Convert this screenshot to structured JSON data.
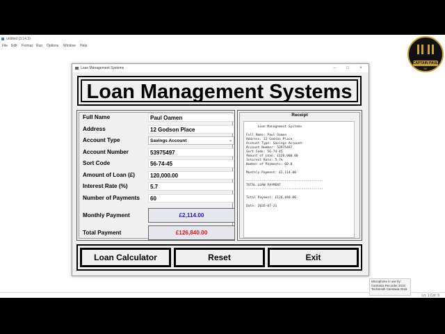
{
  "editor": {
    "title": "untitled (3.14.3)",
    "menu": [
      "File",
      "Edit",
      "Format",
      "Run",
      "Options",
      "Window",
      "Help"
    ],
    "status": "Ln: 1  Col: 0"
  },
  "logo": {
    "text": "CAPTAIN PAUL",
    "subtext": "BE"
  },
  "notice": {
    "lines": [
      "Microphone in use by:",
      "Camtasia Recorder 2018",
      "TechSmith Camtasia 2018"
    ]
  },
  "window": {
    "title": "Loan Management Systems",
    "controls": [
      "–",
      "□",
      "×"
    ]
  },
  "heading": "Loan Management Systems",
  "form": {
    "full_name": {
      "label": "Full Name",
      "value": "Paul Oamen"
    },
    "address": {
      "label": "Address",
      "value": "12 Godson Place"
    },
    "account_type": {
      "label": "Account Type",
      "value": "Savings Account"
    },
    "account_number": {
      "label": "Account Number",
      "value": "53975497"
    },
    "sort_code": {
      "label": "Sort Code",
      "value": "56-74-45"
    },
    "loan_amount": {
      "label": "Amount of Loan (£)",
      "value": "120,000.00"
    },
    "interest_rate": {
      "label": "Interest Rate (%)",
      "value": "5.7"
    },
    "num_payments": {
      "label": "Number of Payments",
      "value": "60"
    },
    "monthly_payment": {
      "label": "Monthly Payment",
      "value": "£2,114.00",
      "color": "#1a1ab8"
    },
    "total_payment": {
      "label": "Total Payment",
      "value": "£126,840.00",
      "color": "#e01010"
    }
  },
  "receipt": {
    "heading": "Receipt",
    "lines": [
      "      Loan Management Systems",
      "",
      "Full Name: Paul Oamen",
      "Address: 12 Godson Place",
      "Account Type: Savings Account",
      "Account Number: 53975497",
      "Sort Code: 56-74-45",
      "Amount of Loan: £120,000.00",
      "Interest Rate: 5.7%",
      "Number of Payments: 60.0",
      "",
      "Monthly Payment: £2,114.00",
      "",
      "----------------------------------------",
      "TOTAL LOAN PAYMENT",
      "----------------------------------------",
      "",
      "Total Payment: £126,840.00",
      "",
      "Date: 2026-07-21"
    ]
  },
  "buttons": {
    "calculate": "Loan Calculator",
    "reset": "Reset",
    "exit": "Exit"
  }
}
